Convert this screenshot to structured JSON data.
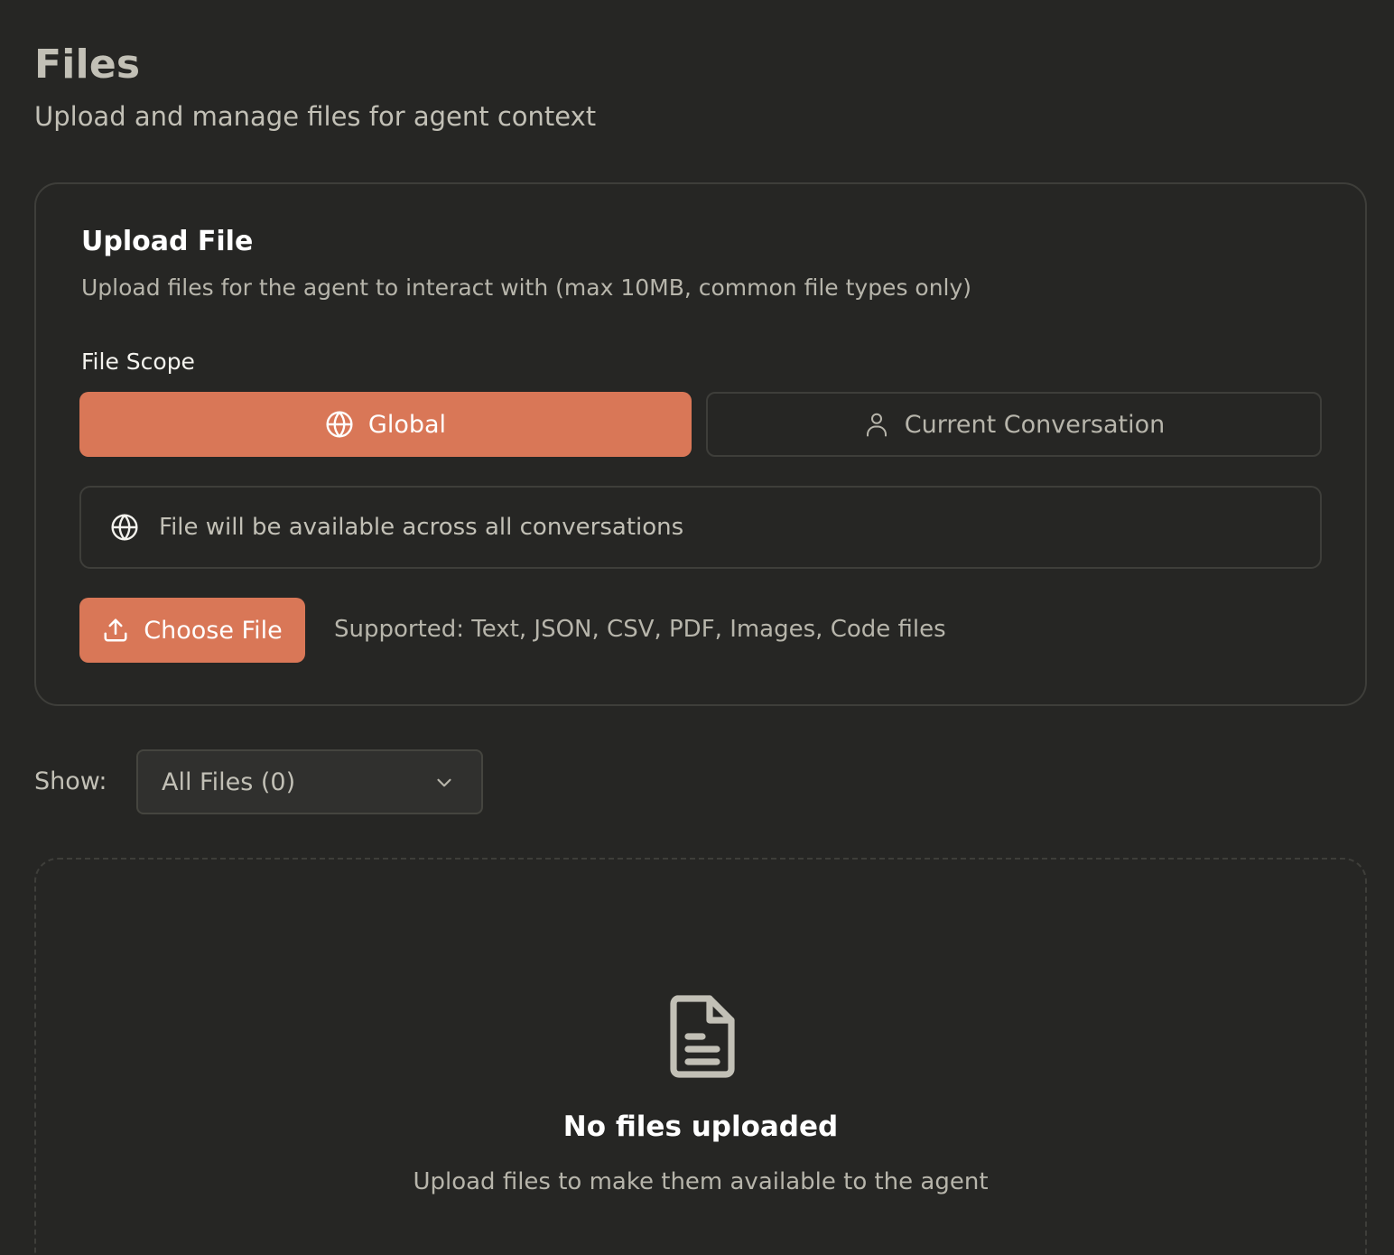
{
  "header": {
    "title": "Files",
    "subtitle": "Upload and manage files for agent context"
  },
  "upload": {
    "title": "Upload File",
    "description": "Upload files for the agent to interact with (max 10MB, common file types only)",
    "scope_label": "File Scope",
    "scope_options": [
      {
        "label": "Global",
        "icon": "globe-icon",
        "selected": true
      },
      {
        "label": "Current Conversation",
        "icon": "user-icon",
        "selected": false
      }
    ],
    "scope_info": "File will be available across all conversations",
    "choose_button": "Choose File",
    "supported": "Supported: Text, JSON, CSV, PDF, Images, Code files"
  },
  "filter": {
    "label": "Show:",
    "selected": "All Files (0)"
  },
  "empty": {
    "title": "No files uploaded",
    "description": "Upload files to make them available to the agent"
  },
  "colors": {
    "background": "#262624",
    "accent": "#d97757",
    "border": "#3e3e3a"
  }
}
